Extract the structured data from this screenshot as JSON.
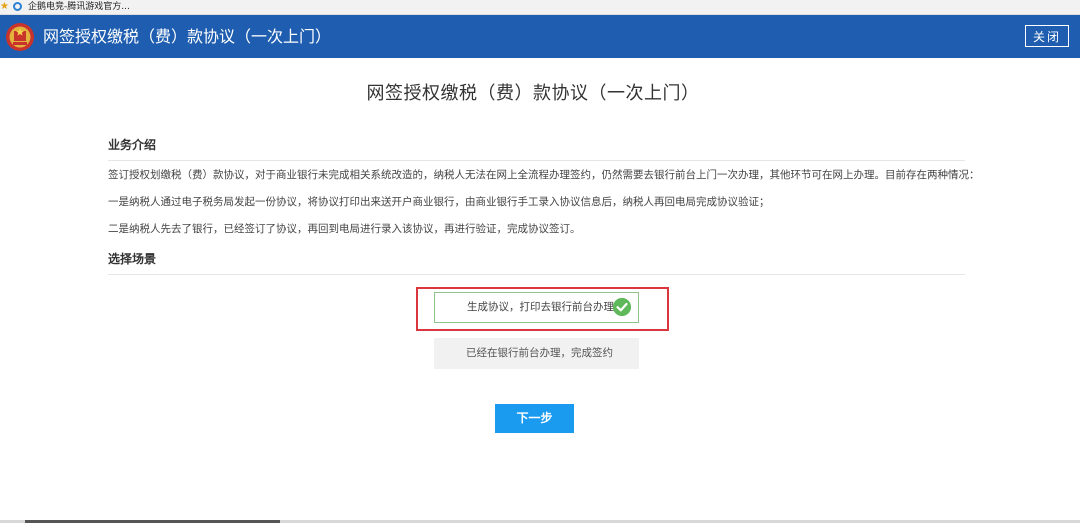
{
  "favorites_bar": {
    "item_label": "企鹅电竞-腾讯游戏官方..."
  },
  "header": {
    "title": "网签授权缴税（费）款协议（一次上门）",
    "close_label": "关闭"
  },
  "page_title": "网签授权缴税（费）款协议（一次上门）",
  "intro": {
    "heading": "业务介绍",
    "paragraphs": [
      "签订授权划缴税（费）款协议，对于商业银行未完成相关系统改造的，纳税人无法在网上全流程办理签约，仍然需要去银行前台上门一次办理，其他环节可在网上办理。目前存在两种情况：",
      "一是纳税人通过电子税务局发起一份协议，将协议打印出来送开户商业银行，由商业银行手工录入协议信息后，纳税人再回电局完成协议验证；",
      "二是纳税人先去了银行，已经签订了协议，再回到电局进行录入该协议，再进行验证，完成协议签订。"
    ]
  },
  "scenario": {
    "heading": "选择场景",
    "options": [
      {
        "label": "生成协议，打印去银行前台办理",
        "selected": true
      },
      {
        "label": "已经在银行前台办理，完成签约",
        "selected": false
      }
    ]
  },
  "next_label": "下一步",
  "colors": {
    "header_bg": "#1e5db0",
    "highlight_border": "#d9363e",
    "check_green": "#5fb85a",
    "primary_button": "#1a9bf0"
  }
}
